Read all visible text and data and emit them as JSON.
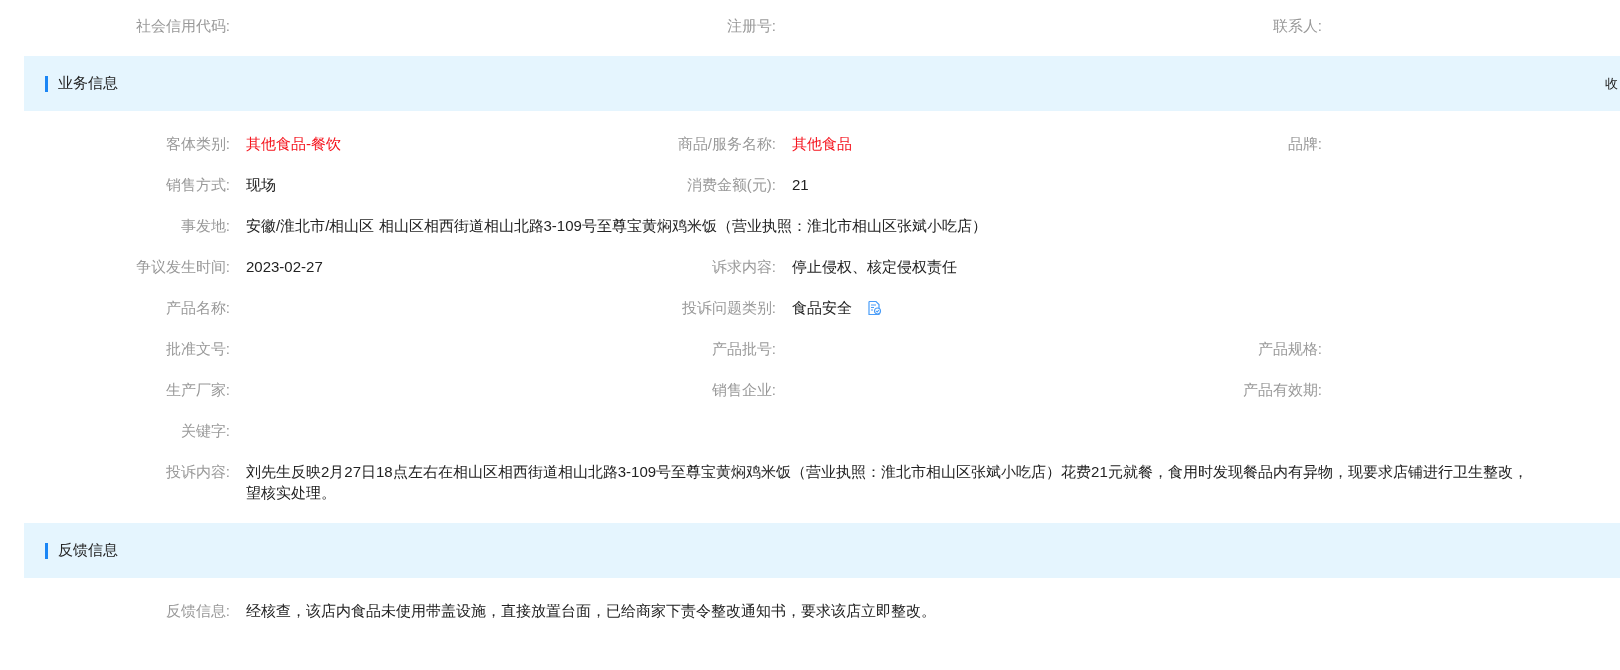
{
  "top_fields": [
    {
      "label": "社会信用代码:"
    },
    {
      "label": "注册号:"
    },
    {
      "label": "联系人:"
    }
  ],
  "sections": [
    {
      "title": "业务信息",
      "toggle": "收",
      "rows": [
        {
          "fields": [
            {
              "label": "客体类别:",
              "value": "其他食品-餐饮",
              "highlighted": true,
              "kind": "field"
            },
            {
              "label": "商品/服务名称:",
              "value": "其他食品",
              "highlighted": true,
              "kind": "field"
            },
            {
              "label": "品牌:",
              "kind": "field"
            }
          ]
        },
        {
          "fields": [
            {
              "label": "销售方式:",
              "value": "现场",
              "highlighted": false,
              "kind": "field"
            },
            {
              "label": "消费金额(元):",
              "value": "21",
              "highlighted": false,
              "kind": "field"
            }
          ]
        },
        {
          "fields": [
            {
              "label": "事发地:",
              "value": "安徽/淮北市/相山区 相山区相西街道相山北路3-109号至尊宝黄焖鸡米饭（营业执照：淮北市相山区张斌小吃店）",
              "highlighted": false,
              "kind": "wide"
            }
          ]
        },
        {
          "fields": [
            {
              "label": "争议发生时间:",
              "value": "2023-02-27",
              "highlighted": false,
              "kind": "field"
            },
            {
              "label": "诉求内容:",
              "value": "停止侵权、核定侵权责任",
              "highlighted": false,
              "kind": "field"
            }
          ]
        },
        {
          "fields": [
            {
              "label": "产品名称:",
              "kind": "field"
            },
            {
              "label": "投诉问题类别:",
              "value": "食品安全",
              "highlighted": false,
              "kind": "tagged"
            }
          ]
        },
        {
          "fields": [
            {
              "label": "批准文号:",
              "kind": "field"
            },
            {
              "label": "产品批号:",
              "kind": "field"
            },
            {
              "label": "产品规格:",
              "kind": "field"
            }
          ]
        },
        {
          "fields": [
            {
              "label": "生产厂家:",
              "kind": "field"
            },
            {
              "label": "销售企业:",
              "kind": "field"
            },
            {
              "label": "产品有效期:",
              "kind": "field"
            }
          ]
        },
        {
          "fields": [
            {
              "label": "关键字:",
              "kind": "wide"
            }
          ]
        },
        {
          "fields": [
            {
              "label": "投诉内容:",
              "value": "刘先生反映2月27日18点左右在相山区相西街道相山北路3-109号至尊宝黄焖鸡米饭（营业执照：淮北市相山区张斌小吃店）花费21元就餐，食用时发现餐品内有异物，现要求店铺进行卫生整改，望核实处理。",
              "highlighted": false,
              "kind": "wide"
            }
          ]
        }
      ]
    },
    {
      "title": "反馈信息",
      "rows": [
        {
          "fields": [
            {
              "label": "反馈信息:",
              "value": "经核查，该店内食品未使用带盖设施，直接放置台面，已给商家下责令整改通知书，要求该店立即整改。",
              "highlighted": false,
              "kind": "wide"
            }
          ]
        }
      ]
    }
  ]
}
